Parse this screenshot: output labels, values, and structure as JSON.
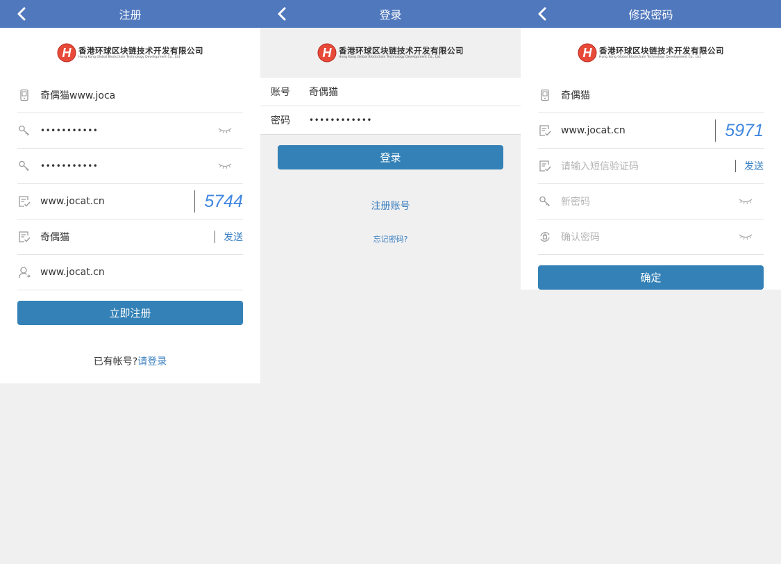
{
  "brand": {
    "cn": "香港环球区块链技术开发有限公司",
    "en": "Hong Kong Global Blockchain Technology Development Co., Ltd.",
    "logo_letter": "H"
  },
  "colors": {
    "header": "#5078bd",
    "button": "#3381b6",
    "link": "#3a80c3",
    "captcha": "#3f86e0"
  },
  "register": {
    "title": "注册",
    "phone_value": "奇偶猫www.joca",
    "password_dots": "•••••••••••",
    "confirm_dots": "•••••••••••",
    "captcha_input": "www.jocat.cn",
    "captcha_code": "5744",
    "sms_value": "奇偶猫",
    "send_label": "发送",
    "invite_value": "www.jocat.cn",
    "submit_label": "立即注册",
    "footer_prompt": "已有帐号?",
    "footer_link": "请登录"
  },
  "login": {
    "title": "登录",
    "account_label": "账号",
    "account_value": "奇偶猫",
    "password_label": "密码",
    "password_dots": "••••••••••••",
    "submit_label": "登录",
    "register_link": "注册账号",
    "forgot_link": "忘记密码?"
  },
  "change_password": {
    "title": "修改密码",
    "phone_value": "奇偶猫",
    "captcha_input": "www.jocat.cn",
    "captcha_code": "5971",
    "sms_placeholder": "请输入短信验证码",
    "send_label": "发送",
    "new_password_placeholder": "新密码",
    "confirm_placeholder": "确认密码",
    "submit_label": "确定"
  }
}
